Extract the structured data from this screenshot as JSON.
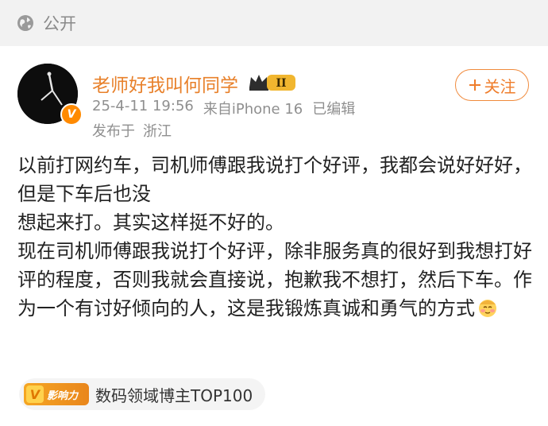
{
  "header": {
    "visibility_label": "公开"
  },
  "post": {
    "username": "老师好我叫何同学",
    "level_badge": "II",
    "date": "25-4-11 19:56",
    "source": "来自iPhone 16",
    "edited": "已编辑",
    "location_prefix": "发布于",
    "location": "浙江",
    "follow_label": "关注",
    "body_lines": [
      "以前打网约车，司机师傅跟我说打个好评，我都会说好好好，但是下车后也没",
      "想起来打。其实这样挺不好的。",
      "现在司机师傅跟我说打个好评，除非服务真的很好到我想打好评的程度，否则我就会直接说，抱歉我不想打，然后下车。作为一个有讨好倾向的人，这是我锻炼真诚和勇气的方式"
    ],
    "influence_badge_label": "影响力",
    "influence_text": "数码领域博主TOP100"
  },
  "colors": {
    "accent": "#ef7d2b",
    "username": "#e8802a",
    "meta": "#8f8f8f"
  },
  "icons": {
    "visibility": "globe-icon",
    "follow": "plus-icon",
    "verified": "verified-v-icon",
    "emoji": "blush-emoji-icon"
  }
}
